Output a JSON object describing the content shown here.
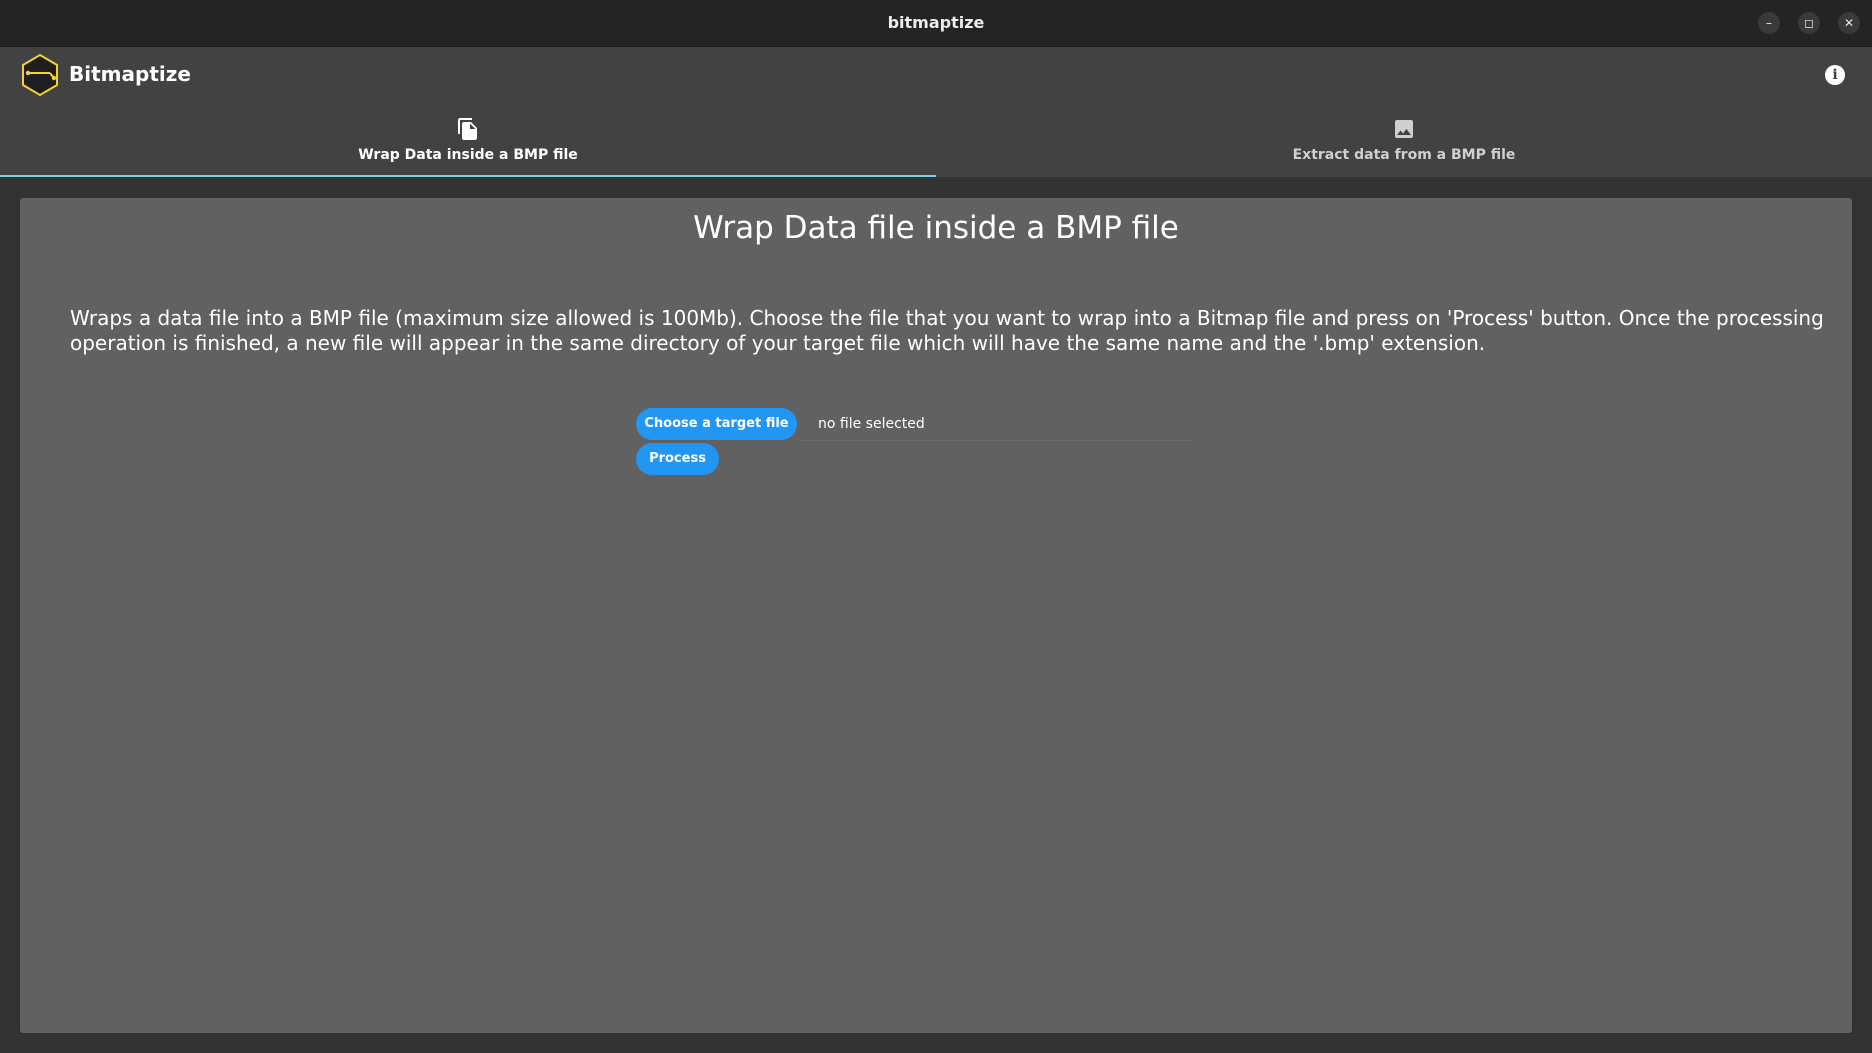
{
  "window": {
    "title": "bitmaptize",
    "minimize_icon": "–",
    "maximize_icon": "◻",
    "close_icon": "✕"
  },
  "app": {
    "name": "Bitmaptize",
    "info_icon": "i"
  },
  "tabs": [
    {
      "label": "Wrap Data inside a BMP file",
      "icon": "file-copy-icon",
      "selected": true
    },
    {
      "label": "Extract data from a BMP file",
      "icon": "image-icon",
      "selected": false
    }
  ],
  "panel": {
    "title": "Wrap Data file inside a BMP file",
    "description": "Wraps a data file into a BMP file (maximum size allowed is 100Mb). Choose the file that you want to wrap into a Bitmap file and press on 'Process' button. Once the processing operation is finished, a new file will appear in the same directory of your target file which will have the same name and the '.bmp' extension.",
    "choose_button": "Choose a target file",
    "file_status": "no file selected",
    "process_button": "Process"
  },
  "colors": {
    "accent": "#2196f3",
    "tab_indicator": "#7fd3e0",
    "panel_bg": "#616161",
    "header_bg": "#424242",
    "logo_hex": "#1e1e1e",
    "logo_stroke": "#f2d22e"
  }
}
